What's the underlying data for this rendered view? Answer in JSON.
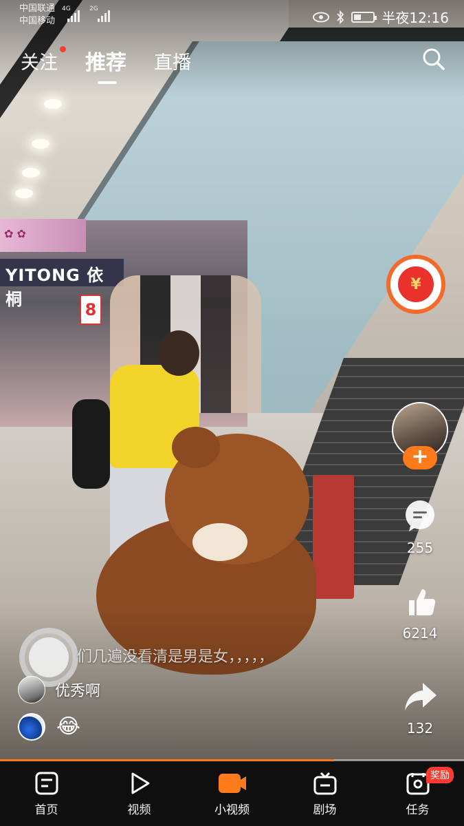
{
  "status_bar": {
    "carrier_top": "中国联通",
    "carrier_bottom": "中国移动",
    "net_top": "4G",
    "net_bottom": "2G",
    "time": "半夜12:16"
  },
  "top_nav": {
    "tabs": [
      {
        "label": "关注",
        "has_dot": true
      },
      {
        "label": "推荐",
        "active": true
      },
      {
        "label": "直播"
      }
    ],
    "search_icon": "search-icon"
  },
  "scene": {
    "store_sign": "YITONG 依桐",
    "price_tag": "8"
  },
  "right_rail": {
    "red_packet_symbol": "¥",
    "follow_symbol": "+",
    "comments": "255",
    "likes": "6214",
    "shares": "132"
  },
  "video_info": {
    "caption": "们几遍没看清是男是女，，，，，",
    "author_name": "优秀啊",
    "reaction_emoji": "😂"
  },
  "progress": {
    "played_fraction": 0.72
  },
  "tab_bar": {
    "items": [
      {
        "label": "首页",
        "icon": "home-icon"
      },
      {
        "label": "视频",
        "icon": "play-icon"
      },
      {
        "label": "小视频",
        "icon": "short-video-icon",
        "active": true
      },
      {
        "label": "剧场",
        "icon": "tv-icon"
      },
      {
        "label": "任务",
        "icon": "task-icon",
        "badge": "奖励"
      }
    ]
  },
  "colors": {
    "accent": "#ff7a1a",
    "badge": "#ff3b30"
  }
}
